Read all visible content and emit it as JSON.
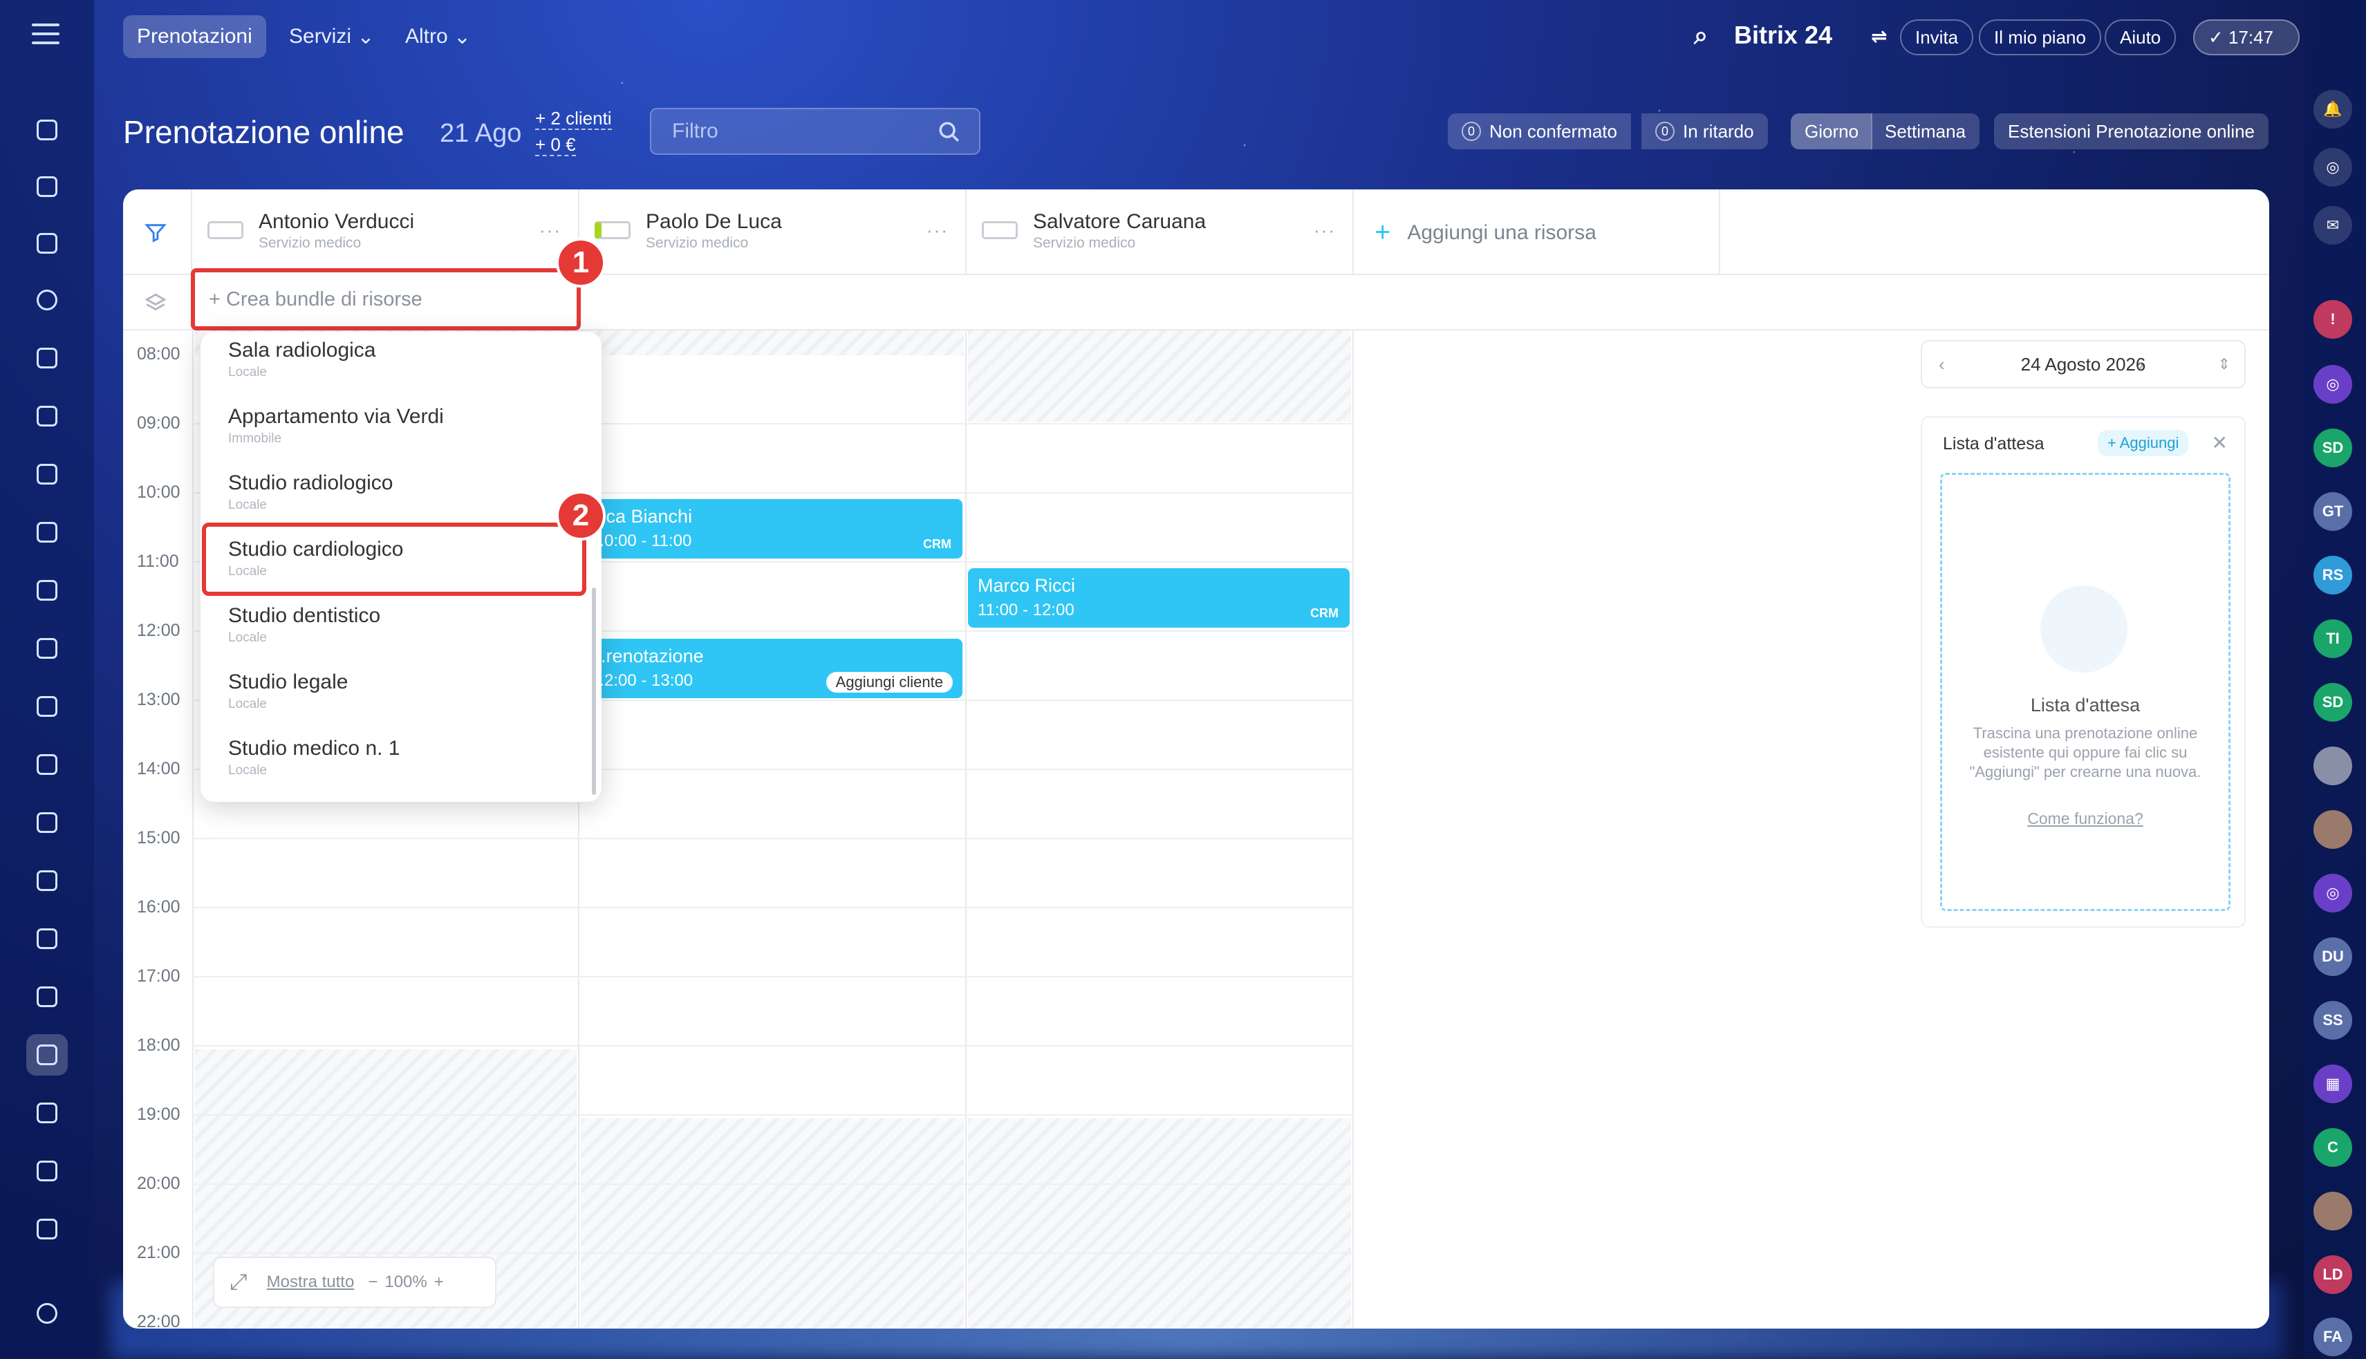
{
  "topbar": {
    "tabs": [
      "Prenotazioni",
      "Servizi",
      "Altro"
    ],
    "brand": "Bitrix 24",
    "invite": "Invita",
    "my_plan": "Il mio piano",
    "help": "Aiuto",
    "clock": "17:47"
  },
  "header": {
    "title": "Prenotazione online",
    "date": "21 Ago",
    "clients": "+ 2 clienti",
    "money": "+ 0 €",
    "filter_placeholder": "Filtro",
    "unconfirmed_count": "0",
    "unconfirmed": "Non confermato",
    "late_count": "0",
    "late": "In ritardo",
    "day": "Giorno",
    "week": "Settimana",
    "extensions": "Estensioni Prenotazione online"
  },
  "resources": [
    {
      "name": "Antonio Verducci",
      "type": "Servizio medico"
    },
    {
      "name": "Paolo De Luca",
      "type": "Servizio medico"
    },
    {
      "name": "Salvatore Caruana",
      "type": "Servizio medico"
    }
  ],
  "add_resource": "Aggiungi una risorsa",
  "bundle_placeholder": "+ Crea bundle di risorse",
  "steps": [
    "1",
    "2"
  ],
  "times": [
    "08:00",
    "09:00",
    "10:00",
    "11:00",
    "12:00",
    "13:00",
    "14:00",
    "15:00",
    "16:00",
    "17:00",
    "18:00",
    "19:00",
    "20:00",
    "21:00",
    "22:00"
  ],
  "dropdown": [
    {
      "name": "Sala radiologica",
      "type": "Locale"
    },
    {
      "name": "Appartamento via Verdi",
      "type": "Immobile"
    },
    {
      "name": "Studio radiologico",
      "type": "Locale"
    },
    {
      "name": "Studio cardiologico",
      "type": "Locale"
    },
    {
      "name": "Studio dentistico",
      "type": "Locale"
    },
    {
      "name": "Studio legale",
      "type": "Locale"
    },
    {
      "name": "Studio medico n. 1",
      "type": "Locale"
    }
  ],
  "events": [
    {
      "title": "...ca Bianchi",
      "time": "...0:00 - 11:00",
      "tag": "CRM"
    },
    {
      "title": "Marco Ricci",
      "time": "11:00 - 12:00",
      "tag": "CRM"
    },
    {
      "title": "...renotazione",
      "time": "...2:00 - 13:00",
      "action": "Aggiungi cliente"
    }
  ],
  "zoom": {
    "show_all": "Mostra tutto",
    "level": "100%"
  },
  "side": {
    "date": "24 Agosto 2026",
    "wait_title": "Lista d'attesa",
    "wait_add": "+ Aggiungi",
    "empty_title": "Lista d'attesa",
    "empty_desc": "Trascina una prenotazione online esistente qui oppure fai clic su \"Aggiungi\" per crearne una nuova.",
    "how": "Come funziona?"
  },
  "right_rail_avatars": [
    "SD",
    "GT",
    "RS",
    "TI",
    "SD",
    "DU",
    "SS",
    "C",
    "LD",
    "FA"
  ]
}
